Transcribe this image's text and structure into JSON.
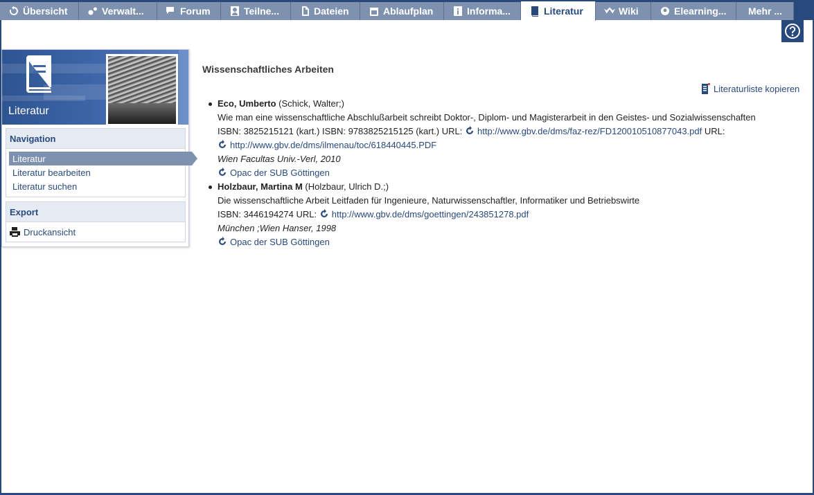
{
  "tabs": [
    {
      "label": "Übersicht",
      "icon": "overview-icon",
      "active": false
    },
    {
      "label": "Verwalt...",
      "icon": "admin-icon",
      "active": false
    },
    {
      "label": "Forum",
      "icon": "forum-icon",
      "active": false
    },
    {
      "label": "Teilne...",
      "icon": "participants-icon",
      "active": false
    },
    {
      "label": "Dateien",
      "icon": "files-icon",
      "active": false
    },
    {
      "label": "Ablaufplan",
      "icon": "schedule-icon",
      "active": false
    },
    {
      "label": "Informa...",
      "icon": "info-icon",
      "active": false
    },
    {
      "label": "Literatur",
      "icon": "book-icon",
      "active": true
    },
    {
      "label": "Wiki",
      "icon": "wiki-icon",
      "active": false
    },
    {
      "label": "Elearning...",
      "icon": "elearning-icon",
      "active": false
    },
    {
      "label": "Mehr ...",
      "icon": "",
      "active": false
    }
  ],
  "sidebar": {
    "title": "Literatur",
    "navigation": {
      "heading": "Navigation",
      "items": [
        "Literatur",
        "Literatur bearbeiten",
        "Literatur suchen"
      ]
    },
    "export": {
      "heading": "Export",
      "items": [
        "Druckansicht"
      ]
    }
  },
  "main": {
    "title": "Wissenschaftliches Arbeiten",
    "copy_link": "Literaturliste kopieren",
    "entries": [
      {
        "author": "Eco, Umberto",
        "editors": "(Schick, Walter;)",
        "title": "Wie man eine wissenschaftliche Abschlußarbeit schreibt Doktor-, Diplom- und Magisterarbeit in den Geistes- und Sozialwissenschaften",
        "isbn_text": "ISBN: 3825215121 (kart.) ISBN: 9783825215125 (kart.) URL:",
        "url1": "http://www.gbv.de/dms/faz-rez/FD120010510877043.pdf",
        "url_label": "URL:",
        "url2": "http://www.gbv.de/dms/ilmenau/toc/618440445.PDF",
        "publisher": "Wien Facultas Univ.-Verl, 2010",
        "opac": "Opac der SUB Göttingen"
      },
      {
        "author": "Holzbaur, Martina M",
        "editors": "(Holzbaur, Ulrich D.;)",
        "title": "Die wissenschaftliche Arbeit Leitfaden für Ingenieure, Naturwissenschaftler, Informatiker und Betriebswirte",
        "isbn_text": "ISBN: 3446194274 URL:",
        "url1": "http://www.gbv.de/dms/goettingen/243851278.pdf",
        "publisher": "München ;Wien Hanser, 1998",
        "opac": "Opac der SUB Göttingen"
      }
    ]
  },
  "colors": {
    "brand": "#28497c",
    "tab_inactive": "#7e92b0",
    "section_bg": "#e6ebf3"
  }
}
